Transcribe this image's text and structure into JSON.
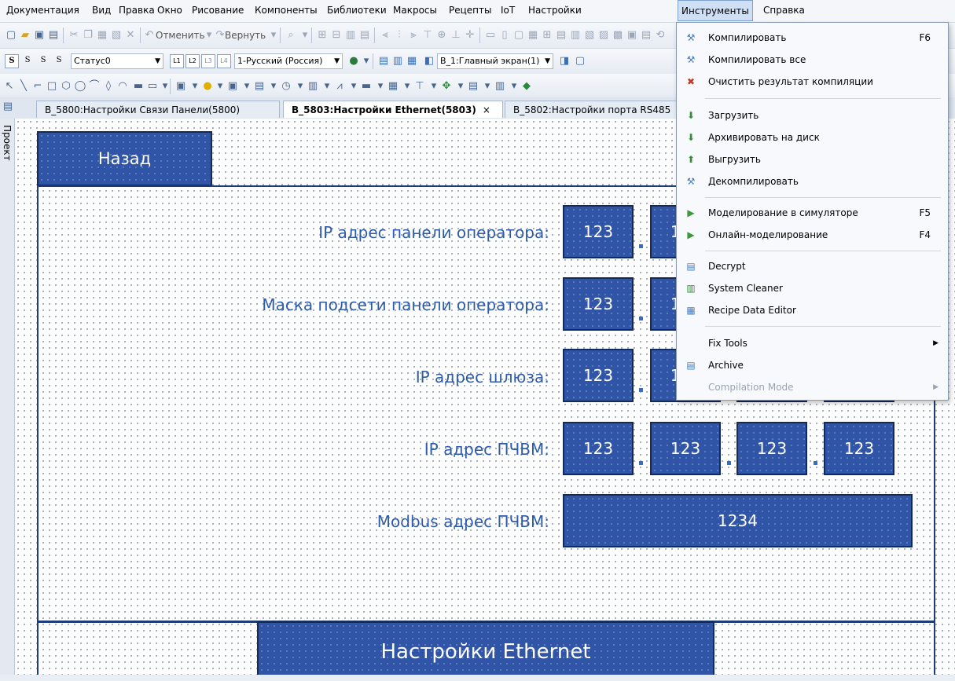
{
  "menubar": {
    "items": [
      "Документация",
      "Вид",
      "Правка",
      "Окно",
      "Рисование",
      "Компоненты",
      "Библиотеки",
      "Макросы",
      "Рецепты",
      "IoT",
      "Настройки",
      "Инструменты",
      "Справка"
    ],
    "active": "Инструменты"
  },
  "toolbar1": {
    "undo_label": "Отменить",
    "redo_label": "Вернуть"
  },
  "toolbar2": {
    "s0": "S",
    "s1": "S",
    "s2": "S",
    "s3": "S",
    "state_combo": "Статус0",
    "l1": "L1",
    "l2": "L2",
    "l3": "L3",
    "l4": "L4",
    "language_combo": "1-Русский (Россия)",
    "screen_combo": "B_1:Главный экран(1)"
  },
  "tabs": [
    {
      "label": "B_5800:Настройки Связи Панели(5800)",
      "active": false
    },
    {
      "label": "B_5803:Настройки Ethernet(5803)",
      "active": true,
      "close": "×"
    },
    {
      "label": "B_5802:Настройки порта RS485",
      "active": false
    }
  ],
  "left_panel": {
    "label": "Проект"
  },
  "canvas": {
    "back_button": "Назад",
    "labels": {
      "ip_panel": "IP адрес панели оператора:",
      "mask": "Маска подсети панели оператора:",
      "gateway": "IP адрес шлюза:",
      "pc_ip": "IP адрес ПЧВМ:",
      "modbus": "Modbus адрес ПЧВМ:"
    },
    "ip_field_value": "123",
    "modbus_value": "1234",
    "footer_title": "Настройки Ethernet"
  },
  "dropdown": {
    "items": {
      "compile": {
        "label": "Компилировать",
        "shortcut": "F6"
      },
      "compile_all": {
        "label": "Компилировать все"
      },
      "clear_compile": {
        "label": "Очистить результат компиляции"
      },
      "download": {
        "label": "Загрузить"
      },
      "archive_disk": {
        "label": "Архивировать на диск"
      },
      "upload": {
        "label": "Выгрузить"
      },
      "decompile": {
        "label": "Декомпилировать"
      },
      "sim": {
        "label": "Моделирование в симуляторе",
        "shortcut": "F5"
      },
      "online_sim": {
        "label": "Онлайн-моделирование",
        "shortcut": "F4"
      },
      "decrypt": {
        "label": "Decrypt"
      },
      "system_cleaner": {
        "label": "System Cleaner"
      },
      "recipe_editor": {
        "label": "Recipe Data Editor"
      },
      "fix_tools": {
        "label": "Fix Tools"
      },
      "archive": {
        "label": "Archive"
      },
      "compilation_mode": {
        "label": "Compilation Mode"
      }
    }
  },
  "colors": {
    "accent_blue": "#3054a6",
    "label_blue": "#2e5ca8",
    "menu_highlight": "#cfe0f5"
  }
}
